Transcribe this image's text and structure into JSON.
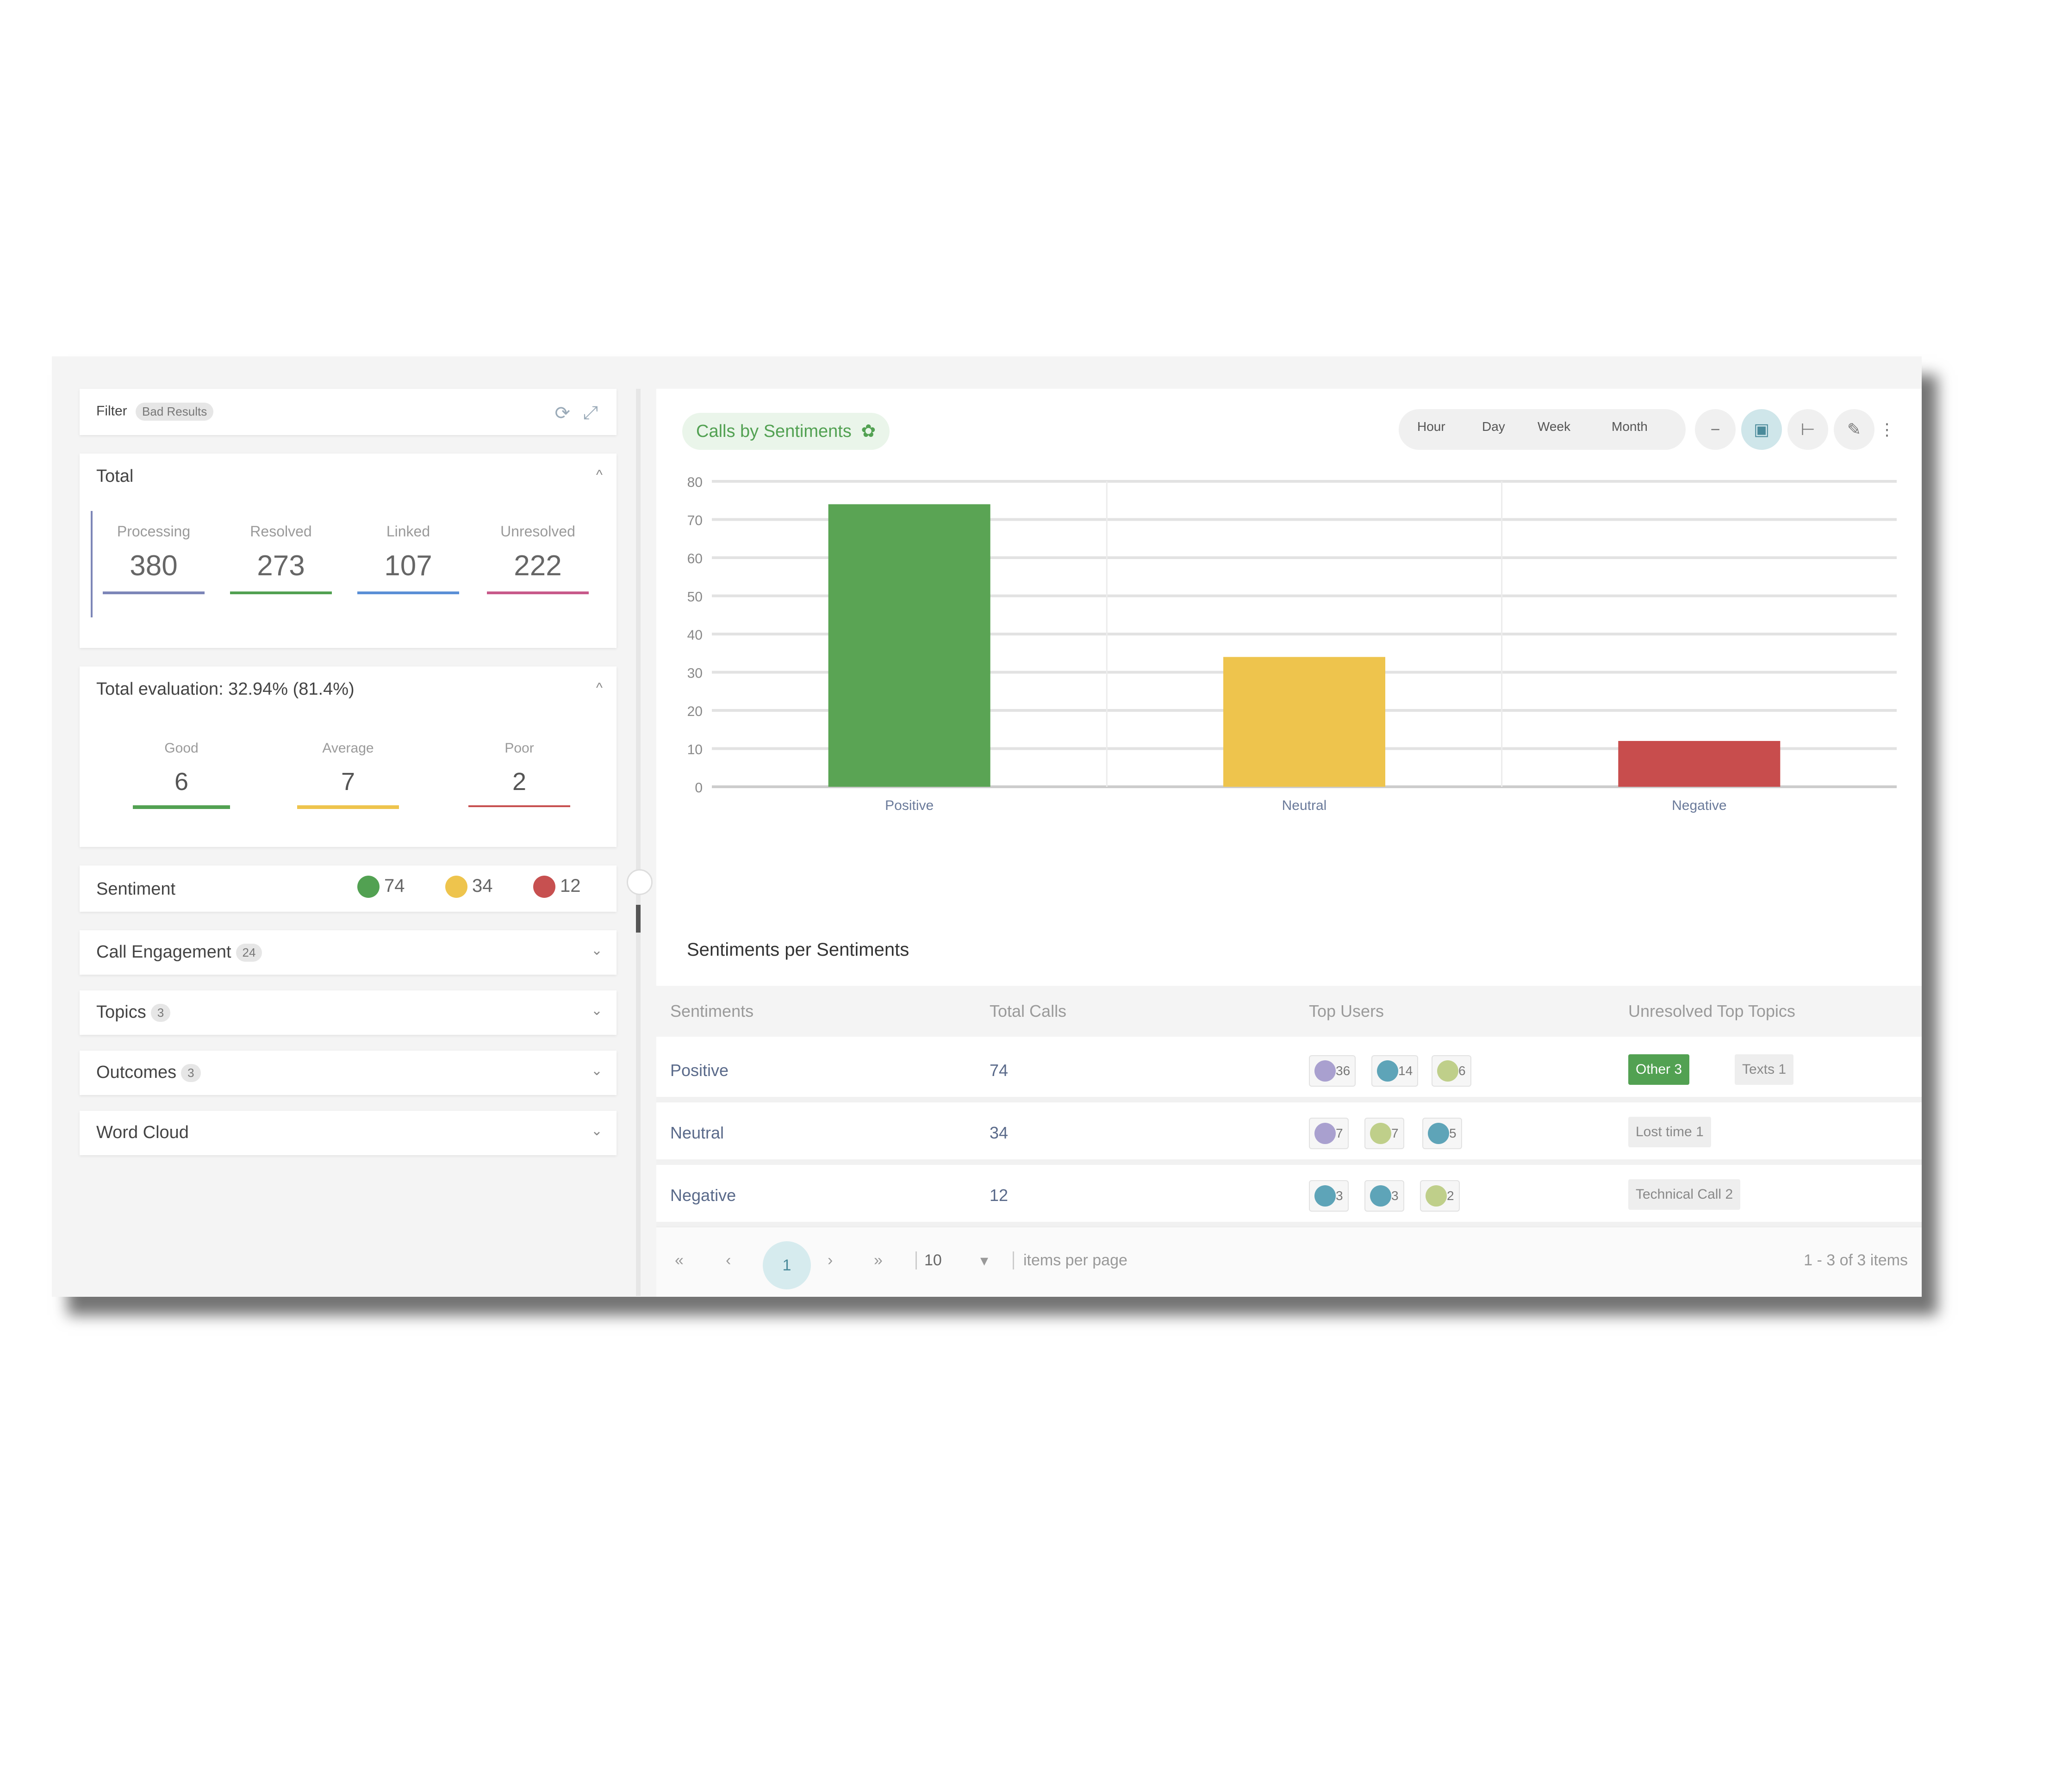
{
  "filter": {
    "label": "Filter",
    "badge": "Bad Results"
  },
  "totals": {
    "title": "Total",
    "stats": [
      {
        "label": "Processing",
        "value": "380",
        "color": "#7d86b8"
      },
      {
        "label": "Resolved",
        "value": "273",
        "color": "#52a152"
      },
      {
        "label": "Linked",
        "value": "107",
        "color": "#5b8fd6"
      },
      {
        "label": "Unresolved",
        "value": "222",
        "color": "#c85a8a"
      }
    ]
  },
  "evaluation": {
    "title": "Total evaluation: 32.94% (81.4%)",
    "items": [
      {
        "label": "Good",
        "value": "6",
        "color": "#52a152"
      },
      {
        "label": "Average",
        "value": "7",
        "color": "#eec44d"
      },
      {
        "label": "Poor",
        "value": "2",
        "color": "#c75050"
      }
    ]
  },
  "sentiment": {
    "title": "Sentiment",
    "positive": "74",
    "neutral": "34",
    "negative": "12",
    "colors": {
      "positive": "#52a152",
      "neutral": "#eec44d",
      "negative": "#c75050"
    }
  },
  "collapsed": [
    {
      "title": "Call Engagement",
      "badge": "24"
    },
    {
      "title": "Topics",
      "badge": "3"
    },
    {
      "title": "Outcomes",
      "badge": "3"
    },
    {
      "title": "Word Cloud",
      "badge": ""
    }
  ],
  "chart_header": {
    "title": "Calls by Sentiments",
    "toolbar": [
      "Hour",
      "Day",
      "Week",
      "Month"
    ],
    "icons": [
      "minus-icon",
      "table-icon",
      "bars-icon",
      "edit-icon",
      "more-icon"
    ]
  },
  "chart_data": {
    "type": "bar",
    "categories": [
      "Positive",
      "Neutral",
      "Negative"
    ],
    "values": [
      74,
      34,
      12
    ],
    "colors": [
      "#5aa454",
      "#eec44d",
      "#c84d4d"
    ],
    "yticks": [
      0,
      10,
      20,
      30,
      40,
      50,
      60,
      70,
      80
    ],
    "ylim": [
      0,
      80
    ],
    "legend": "Calls by Sentiments",
    "legend_position": "bottom",
    "grid": true
  },
  "table": {
    "title": "Sentiments per Sentiments",
    "columns": [
      "Sentiments",
      "Total Calls",
      "Top Users",
      "Unresolved Top Topics"
    ],
    "rows": [
      {
        "name": "Positive",
        "calls": "74",
        "users": [
          {
            "value": "36",
            "color": "#a9a0cf"
          },
          {
            "value": "14",
            "color": "#5ea4b8"
          },
          {
            "value": "6",
            "color": "#bfcf8a"
          }
        ],
        "topics": [
          {
            "label": "Other",
            "count": "3",
            "bg": "#52a152",
            "fg": "#ffffff"
          },
          {
            "label": "Texts",
            "count": "1",
            "bg": "#eeeeee",
            "fg": "#888888"
          }
        ]
      },
      {
        "name": "Neutral",
        "calls": "34",
        "users": [
          {
            "value": "7",
            "color": "#a9a0cf"
          },
          {
            "value": "7",
            "color": "#bfcf8a"
          },
          {
            "value": "5",
            "color": "#5ea4b8"
          }
        ],
        "topics": [
          {
            "label": "Lost time",
            "count": "1",
            "bg": "#eeeeee",
            "fg": "#888888"
          }
        ]
      },
      {
        "name": "Negative",
        "calls": "12",
        "users": [
          {
            "value": "3",
            "color": "#5ea4b8"
          },
          {
            "value": "3",
            "color": "#5ea4b8"
          },
          {
            "value": "2",
            "color": "#bfcf8a"
          }
        ],
        "topics": [
          {
            "label": "Technical Call",
            "count": "2",
            "bg": "#eeeeee",
            "fg": "#888888"
          }
        ]
      }
    ]
  },
  "pager": {
    "current": "1",
    "per_page": "10",
    "per_page_label": "items per page",
    "summary": "1 - 3 of 3 items"
  }
}
